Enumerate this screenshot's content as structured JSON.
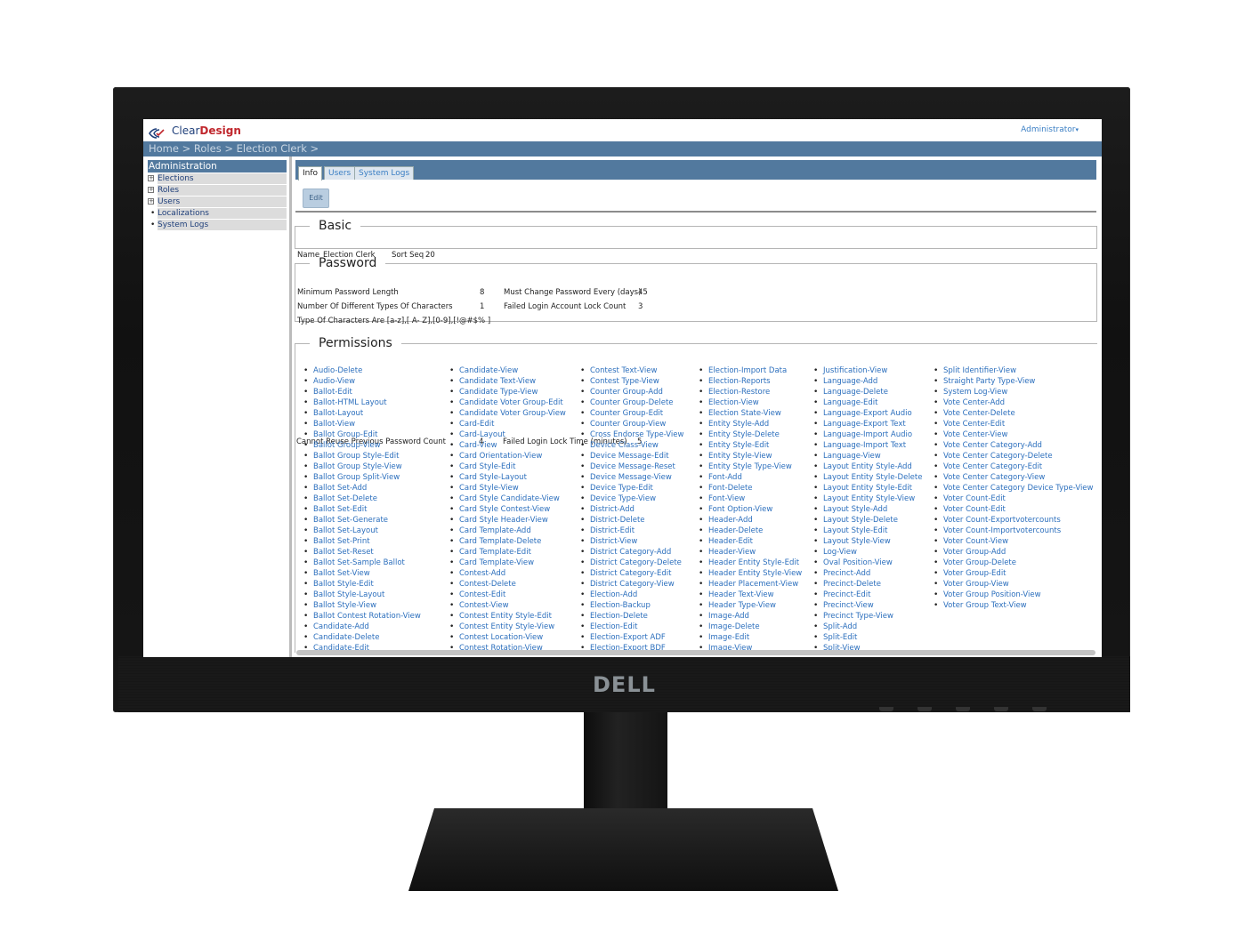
{
  "device": {
    "brand": "DELL"
  },
  "app": {
    "logo_text_plain": "Clear",
    "logo_text_bold": "Design",
    "user_menu": "Administrator"
  },
  "breadcrumb": [
    "Home",
    "Roles",
    "Election Clerk"
  ],
  "sidebar": {
    "title": "Administration",
    "items": [
      {
        "label": "Elections",
        "type": "expandable"
      },
      {
        "label": "Roles",
        "type": "expandable"
      },
      {
        "label": "Users",
        "type": "expandable"
      },
      {
        "label": "Localizations",
        "type": "leaf"
      },
      {
        "label": "System Logs",
        "type": "leaf"
      }
    ]
  },
  "tabs": [
    {
      "label": "Info",
      "active": true
    },
    {
      "label": "Users",
      "active": false
    },
    {
      "label": "System Logs",
      "active": false
    }
  ],
  "edit_label": "Edit",
  "basic": {
    "title": "Basic",
    "name_label": "Name",
    "name_value": "Election Clerk",
    "sort_label": "Sort Seq",
    "sort_value": "20"
  },
  "password": {
    "title": "Password",
    "min_length_label": "Minimum Password Length",
    "min_length_value": "8",
    "change_every_label": "Must Change Password Every (days)",
    "change_every_value": "45",
    "diff_types_label": "Number Of Different Types Of Characters",
    "diff_types_value": "1",
    "lock_count_label": "Failed Login Account Lock Count",
    "lock_count_value": "3",
    "types_text": "Type Of Characters Are [a-z],[ A- Z],[0-9],[!@#$% ]",
    "reuse_label": "Cannot Reuse Previous Password Count",
    "reuse_value": "4",
    "lock_time_label": "Failed Login Lock Time (minutes)",
    "lock_time_value": "5"
  },
  "permissions": {
    "title": "Permissions",
    "columns": [
      [
        "Audio-Delete",
        "Audio-View",
        "Ballot-Edit",
        "Ballot-HTML Layout",
        "Ballot-Layout",
        "Ballot-View",
        "Ballot Group-Edit",
        "Ballot Group-View",
        "Ballot Group Style-Edit",
        "Ballot Group Style-View",
        "Ballot Group Split-View",
        "Ballot Set-Add",
        "Ballot Set-Delete",
        "Ballot Set-Edit",
        "Ballot Set-Generate",
        "Ballot Set-Layout",
        "Ballot Set-Print",
        "Ballot Set-Reset",
        "Ballot Set-Sample Ballot",
        "Ballot Set-View",
        "Ballot Style-Edit",
        "Ballot Style-Layout",
        "Ballot Style-View",
        "Ballot Contest Rotation-View",
        "Candidate-Add",
        "Candidate-Delete",
        "Candidate-Edit"
      ],
      [
        "Candidate-View",
        "Candidate Text-View",
        "Candidate Type-View",
        "Candidate Voter Group-Edit",
        "Candidate Voter Group-View",
        "Card-Edit",
        "Card-Layout",
        "Card-View",
        "Card Orientation-View",
        "Card Style-Edit",
        "Card Style-Layout",
        "Card Style-View",
        "Card Style Candidate-View",
        "Card Style Contest-View",
        "Card Style Header-View",
        "Card Template-Add",
        "Card Template-Delete",
        "Card Template-Edit",
        "Card Template-View",
        "Contest-Add",
        "Contest-Delete",
        "Contest-Edit",
        "Contest-View",
        "Contest Entity Style-Edit",
        "Contest Entity Style-View",
        "Contest Location-View",
        "Contest Rotation-View"
      ],
      [
        "Contest Text-View",
        "Contest Type-View",
        "Counter Group-Add",
        "Counter Group-Delete",
        "Counter Group-Edit",
        "Counter Group-View",
        "Cross Endorse Type-View",
        "Device Class-View",
        "Device Message-Edit",
        "Device Message-Reset",
        "Device Message-View",
        "Device Type-Edit",
        "Device Type-View",
        "District-Add",
        "District-Delete",
        "District-Edit",
        "District-View",
        "District Category-Add",
        "District Category-Delete",
        "District Category-Edit",
        "District Category-View",
        "Election-Add",
        "Election-Backup",
        "Election-Delete",
        "Election-Edit",
        "Election-Export ADF",
        "Election-Export BDF"
      ],
      [
        "Election-Import Data",
        "Election-Reports",
        "Election-Restore",
        "Election-View",
        "Election State-View",
        "Entity Style-Add",
        "Entity Style-Delete",
        "Entity Style-Edit",
        "Entity Style-View",
        "Entity Style Type-View",
        "Font-Add",
        "Font-Delete",
        "Font-View",
        "Font Option-View",
        "Header-Add",
        "Header-Delete",
        "Header-Edit",
        "Header-View",
        "Header Entity Style-Edit",
        "Header Entity Style-View",
        "Header Placement-View",
        "Header Text-View",
        "Header Type-View",
        "Image-Add",
        "Image-Delete",
        "Image-Edit",
        "Image-View"
      ],
      [
        "Justification-View",
        "Language-Add",
        "Language-Delete",
        "Language-Edit",
        "Language-Export Audio",
        "Language-Export Text",
        "Language-Import Audio",
        "Language-Import Text",
        "Language-View",
        "Layout Entity Style-Add",
        "Layout Entity Style-Delete",
        "Layout Entity Style-Edit",
        "Layout Entity Style-View",
        "Layout Style-Add",
        "Layout Style-Delete",
        "Layout Style-Edit",
        "Layout Style-View",
        "Log-View",
        "Oval Position-View",
        "Precinct-Add",
        "Precinct-Delete",
        "Precinct-Edit",
        "Precinct-View",
        "Precinct Type-View",
        "Split-Add",
        "Split-Edit",
        "Split-View"
      ],
      [
        "Split Identifier-View",
        "Straight Party Type-View",
        "System Log-View",
        "Vote Center-Add",
        "Vote Center-Delete",
        "Vote Center-Edit",
        "Vote Center-View",
        "Vote Center Category-Add",
        "Vote Center Category-Delete",
        "Vote Center Category-Edit",
        "Vote Center Category-View",
        "Vote Center Category Device Type-View",
        "Voter Count-Edit",
        "Voter Count-Edit",
        "Voter Count-Exportvotercounts",
        "Voter Count-Importvotercounts",
        "Voter Count-View",
        "Voter Group-Add",
        "Voter Group-Delete",
        "Voter Group-Edit",
        "Voter Group-View",
        "Voter Group Position-View",
        "Voter Group Text-View"
      ]
    ]
  },
  "colors": {
    "header_blue": "#52799e",
    "link_blue": "#2c6fbd",
    "logo_navy": "#1f3f7a",
    "logo_red": "#c0272d"
  }
}
